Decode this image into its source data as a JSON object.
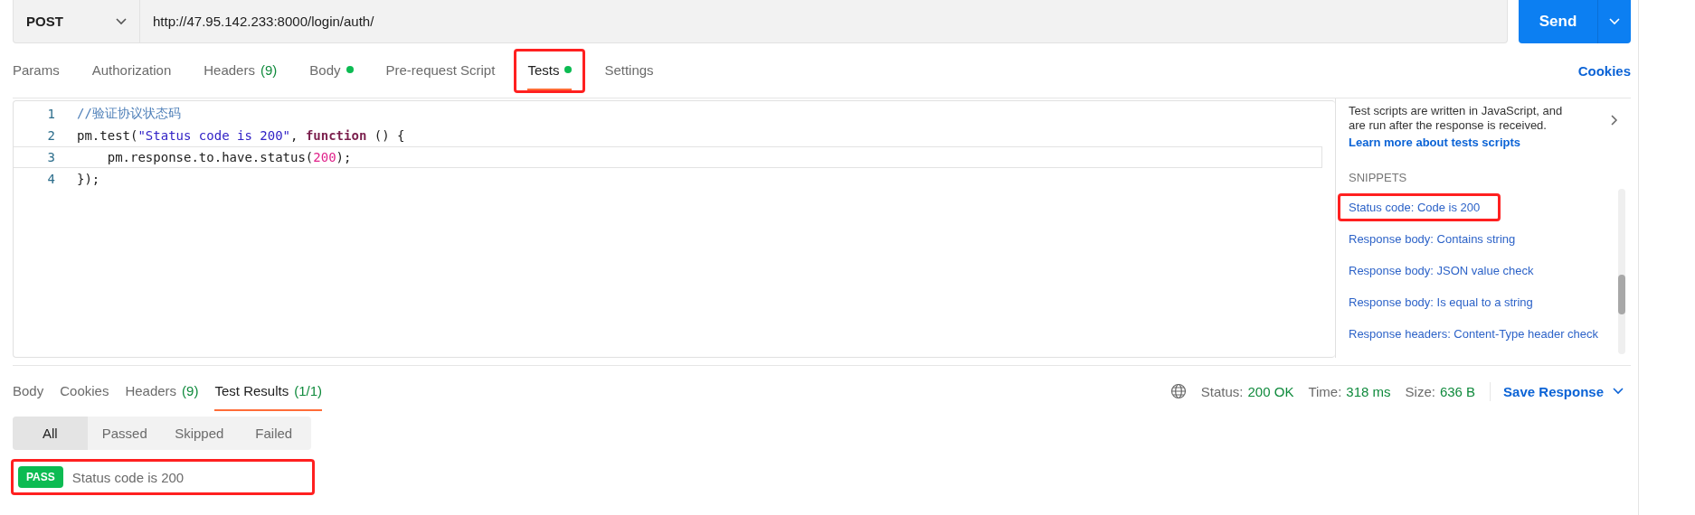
{
  "request": {
    "method": "POST",
    "url": "http://47.95.142.233:8000/login/auth/",
    "send_label": "Send"
  },
  "request_tabs": [
    {
      "label": "Params",
      "selected": false
    },
    {
      "label": "Authorization",
      "selected": false
    },
    {
      "label": "Headers",
      "count": "(9)",
      "selected": false
    },
    {
      "label": "Body",
      "dot": true,
      "selected": false
    },
    {
      "label": "Pre-request Script",
      "selected": false
    },
    {
      "label": "Tests",
      "dot": true,
      "selected": true,
      "highlighted": true
    },
    {
      "label": "Settings",
      "selected": false
    }
  ],
  "cookies_link": "Cookies",
  "editor": {
    "lines": [
      {
        "number": "1",
        "active": false,
        "tokens": [
          {
            "kind": "comment",
            "text": "//验证协议状态码"
          }
        ]
      },
      {
        "number": "2",
        "active": false,
        "tokens": [
          {
            "kind": "plain",
            "text": "pm.test("
          },
          {
            "kind": "string",
            "text": "\"Status code is 200\""
          },
          {
            "kind": "plain",
            "text": ", "
          },
          {
            "kind": "keyword",
            "text": "function"
          },
          {
            "kind": "plain",
            "text": " () {"
          }
        ]
      },
      {
        "number": "3",
        "active": true,
        "tokens": [
          {
            "kind": "plain",
            "text": "    pm.response.to.have.status("
          },
          {
            "kind": "number",
            "text": "200"
          },
          {
            "kind": "plain",
            "text": ");"
          }
        ]
      },
      {
        "number": "4",
        "active": false,
        "tokens": [
          {
            "kind": "plain",
            "text": "});"
          }
        ]
      }
    ]
  },
  "side_panel": {
    "intro": "Test scripts are written in JavaScript, and are run after the response is received.",
    "learn_link": "Learn more about tests scripts",
    "snippets_heading": "SNIPPETS",
    "snippets": [
      {
        "label": "Status code: Code is 200",
        "highlighted": true
      },
      {
        "label": "Response body: Contains string",
        "highlighted": false
      },
      {
        "label": "Response body: JSON value check",
        "highlighted": false
      },
      {
        "label": "Response body: Is equal to a string",
        "highlighted": false
      },
      {
        "label": "Response headers: Content-Type header check",
        "highlighted": false
      }
    ]
  },
  "response_tabs": [
    {
      "label": "Body",
      "selected": false
    },
    {
      "label": "Cookies",
      "selected": false
    },
    {
      "label": "Headers",
      "count": "(9)",
      "selected": false
    },
    {
      "label": "Test Results",
      "count": "(1/1)",
      "selected": true
    }
  ],
  "response_meta": [
    {
      "label": "Status:",
      "value": "200 OK"
    },
    {
      "label": "Time:",
      "value": "318 ms"
    },
    {
      "label": "Size:",
      "value": "636 B"
    }
  ],
  "save_response": "Save Response",
  "filters": [
    {
      "label": "All",
      "selected": true
    },
    {
      "label": "Passed",
      "selected": false
    },
    {
      "label": "Skipped",
      "selected": false
    },
    {
      "label": "Failed",
      "selected": false
    }
  ],
  "results": [
    {
      "badge": "PASS",
      "name": "Status code is 200",
      "highlighted": true
    }
  ]
}
